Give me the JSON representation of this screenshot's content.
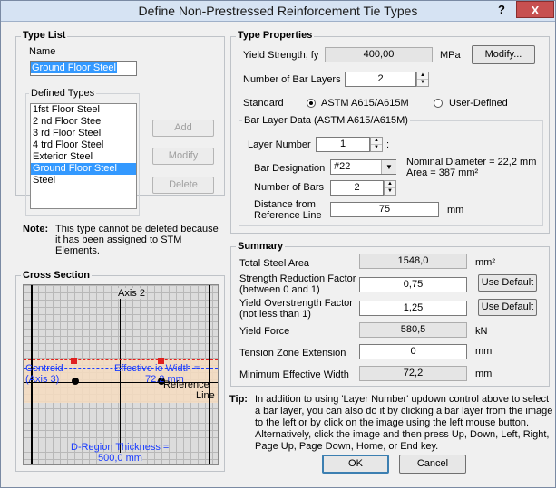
{
  "window": {
    "title": "Define Non-Prestressed Reinforcement Tie Types",
    "help": "?",
    "close": "X"
  },
  "type_list": {
    "title": "Type List",
    "name_label": "Name",
    "name_value": "Ground Floor Steel",
    "defined_types_label": "Defined Types",
    "items": [
      "1fst  Floor  Steel",
      "2 nd Floor Steel",
      "3 rd Floor Steel",
      "4 trd Floor Steel",
      "Exterior Steel",
      "Ground Floor Steel",
      "Steel"
    ],
    "add": "Add",
    "modify": "Modify",
    "delete": "Delete",
    "note_label": "Note:",
    "note_text_1": "This type cannot be deleted because",
    "note_text_2": "it has been assigned to STM",
    "note_text_3": "Elements."
  },
  "cross_section": {
    "title": "Cross Section",
    "axis2": "Axis 2",
    "centroid": "Centroid",
    "axis3": "(Axis 3)",
    "effective_width": "Effective  ie Width =",
    "effective_value": "72.2 mm",
    "reference": "Reference",
    "line": "Line",
    "thickness": "D-Region Thickness =",
    "thickness_value": "500,0 mm"
  },
  "type_properties": {
    "title": "Type Properties",
    "yield_label": "Yield Strength, fy",
    "yield_value": "400,00",
    "yield_unit": "MPa",
    "modify": "Modify...",
    "layers_label": "Number of Bar Layers",
    "layers_value": "2",
    "standard_label": "Standard",
    "astm_label": "ASTM A615/A615M",
    "user_label": "User-Defined",
    "bar_layer_title": "Bar Layer Data (ASTM A615/A615M)",
    "layer_number_label": "Layer Number",
    "layer_number_value": "1",
    "layer_colon": ":",
    "bar_designation_label": "Bar Designation",
    "bar_designation_value": "#22",
    "nominal_diameter": "Nominal Diameter = 22,2 mm",
    "area": "Area = 387 mm²",
    "number_bars_label": "Number of Bars",
    "number_bars_value": "2",
    "distance_label_1": "Distance from",
    "distance_label_2": "Reference Line",
    "distance_value": "75",
    "distance_unit": "mm"
  },
  "summary": {
    "title": "Summary",
    "total_area_label": "Total Steel Area",
    "total_area_value": "1548,0",
    "total_area_unit": "mm²",
    "srf_label_1": "Strength Reduction Factor",
    "srf_label_2": "(between 0 and 1)",
    "srf_value": "0,75",
    "use_default": "Use Default",
    "yof_label_1": "Yield Overstrength Factor",
    "yof_label_2": "(not less than 1)",
    "yof_value": "1,25",
    "yield_force_label": "Yield Force",
    "yield_force_value": "580,5",
    "yield_force_unit": "kN",
    "tension_label": "Tension Zone Extension",
    "tension_value": "0",
    "tension_unit": "mm",
    "min_width_label": "Minimum Effective Width",
    "min_width_value": "72,2",
    "min_width_unit": "mm"
  },
  "tip": {
    "label": "Tip:",
    "lines": [
      "In addition to using 'Layer Number' updown control above to select",
      "a bar layer, you can also do it by clicking a bar layer from the image",
      "to the left or by click on the image using the left mouse button.",
      "Alternatively, click the image and then press Up, Down, Left, Right,",
      "Page Up, Page Down, Home, or End key."
    ]
  },
  "buttons": {
    "ok": "OK",
    "cancel": "Cancel"
  },
  "colors": {
    "selection": "#3399ff",
    "bar_red": "#e02020",
    "bar_black": "#000000",
    "dim_blue": "#1a3cff",
    "zone": "#f6dcc0"
  }
}
